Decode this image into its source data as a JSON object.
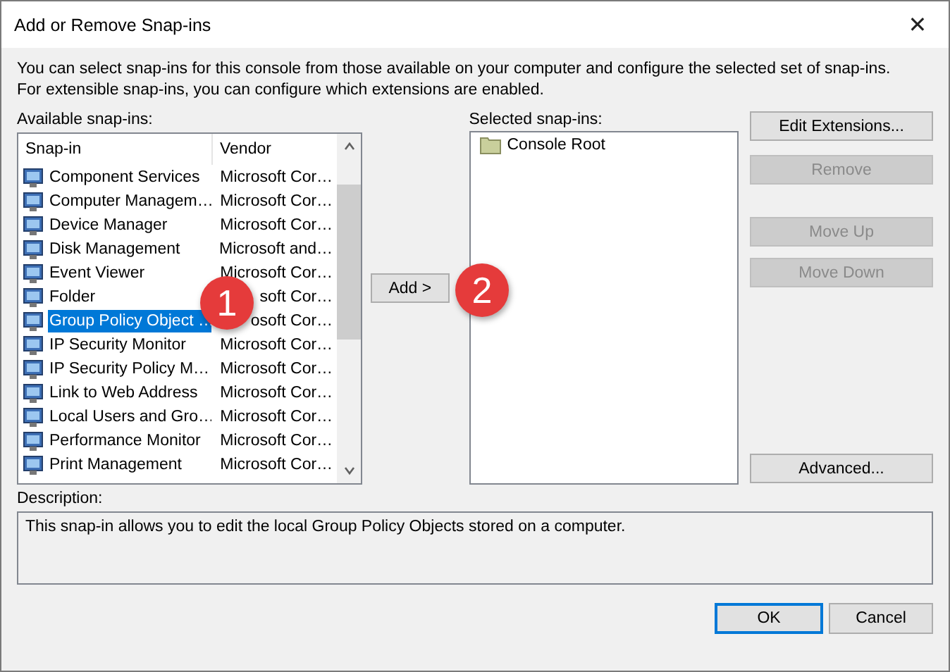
{
  "window": {
    "title": "Add or Remove Snap-ins",
    "close": "✕"
  },
  "intro": "You can select snap-ins for this console from those available on your computer and configure the selected set of snap-ins. For extensible snap-ins, you can configure which extensions are enabled.",
  "available": {
    "label": "Available snap-ins:",
    "columns": [
      "Snap-in",
      "Vendor"
    ],
    "rows": [
      {
        "name": "Component Services",
        "vendor": "Microsoft Cor…",
        "selected": false
      },
      {
        "name": "Computer Managem…",
        "vendor": "Microsoft Cor…",
        "selected": false
      },
      {
        "name": "Device Manager",
        "vendor": "Microsoft Cor…",
        "selected": false
      },
      {
        "name": "Disk Management",
        "vendor": "Microsoft and…",
        "selected": false
      },
      {
        "name": "Event Viewer",
        "vendor": "Microsoft Cor…",
        "selected": false
      },
      {
        "name": "Folder",
        "vendor": "soft Cor…",
        "selected": false
      },
      {
        "name": "Group Policy Object …",
        "vendor": "osoft Cor…",
        "selected": true
      },
      {
        "name": "IP Security Monitor",
        "vendor": "Microsoft Cor…",
        "selected": false
      },
      {
        "name": "IP Security Policy M…",
        "vendor": "Microsoft Cor…",
        "selected": false
      },
      {
        "name": "Link to Web Address",
        "vendor": "Microsoft Cor…",
        "selected": false
      },
      {
        "name": "Local Users and Gro…",
        "vendor": "Microsoft Cor…",
        "selected": false
      },
      {
        "name": "Performance Monitor",
        "vendor": "Microsoft Cor…",
        "selected": false
      },
      {
        "name": "Print Management",
        "vendor": "Microsoft Cor…",
        "selected": false
      }
    ]
  },
  "add_button": {
    "label": "Add >"
  },
  "selected": {
    "label": "Selected snap-ins:",
    "items": [
      "Console Root"
    ]
  },
  "side_buttons": [
    {
      "label": "Edit Extensions...",
      "disabled": false
    },
    {
      "label": "Remove",
      "disabled": true
    },
    {
      "label": "Move Up",
      "disabled": true
    },
    {
      "label": "Move Down",
      "disabled": true
    },
    {
      "label": "Advanced...",
      "disabled": false
    }
  ],
  "description": {
    "label": "Description:",
    "text": "This snap-in allows you to edit the local Group Policy Objects stored on a computer."
  },
  "callouts": [
    "1",
    "2"
  ],
  "footer_buttons": [
    {
      "label": "OK",
      "default": true
    },
    {
      "label": "Cancel",
      "default": false
    }
  ]
}
